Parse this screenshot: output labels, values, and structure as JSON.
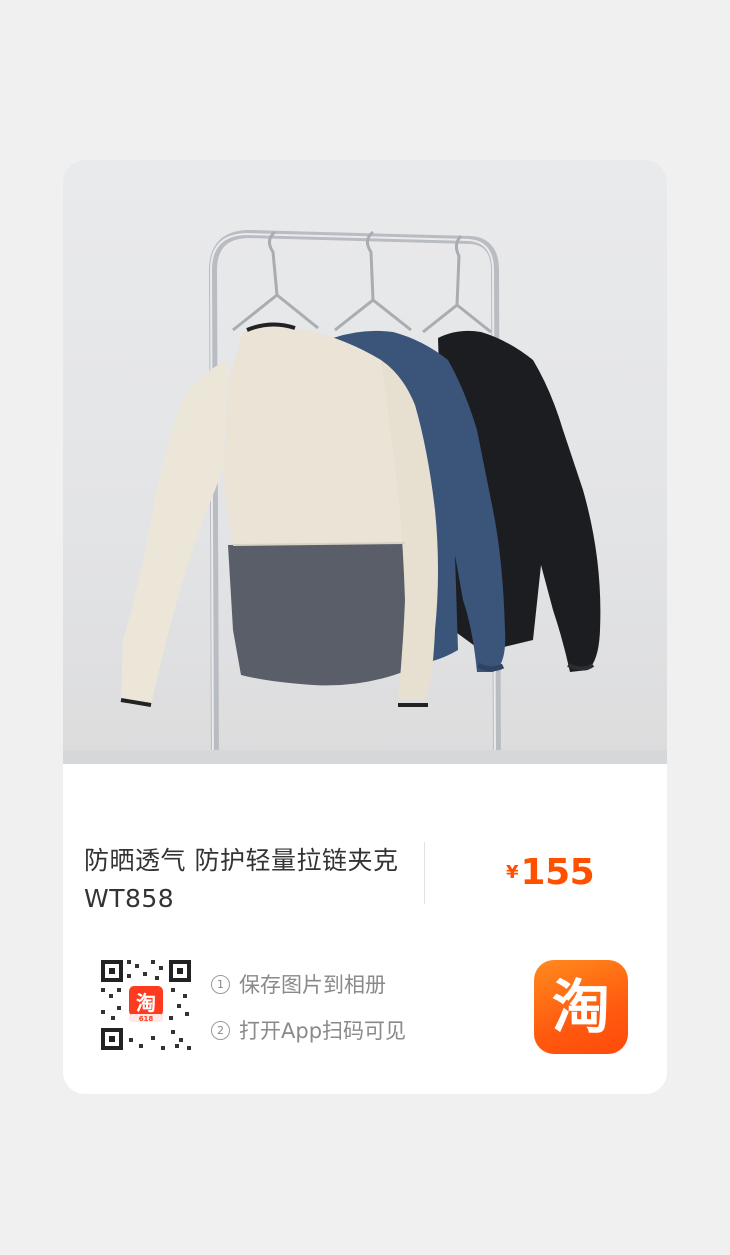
{
  "product": {
    "title": "防晒透气 防护轻量拉链夹克 WT858",
    "currency": "¥",
    "price": "155"
  },
  "qr": {
    "badge_glyph": "淘",
    "badge_caption": "618"
  },
  "steps": [
    {
      "num": "1",
      "text": "保存图片到相册"
    },
    {
      "num": "2",
      "text": "打开App扫码可见"
    }
  ],
  "app_icon": {
    "glyph": "淘"
  },
  "colors": {
    "accent": "#ff5000",
    "jacket_cream": "#ebe4d6",
    "jacket_gray": "#5a5e69",
    "jacket_blue": "#3b5479",
    "jacket_black": "#1c1d21"
  }
}
